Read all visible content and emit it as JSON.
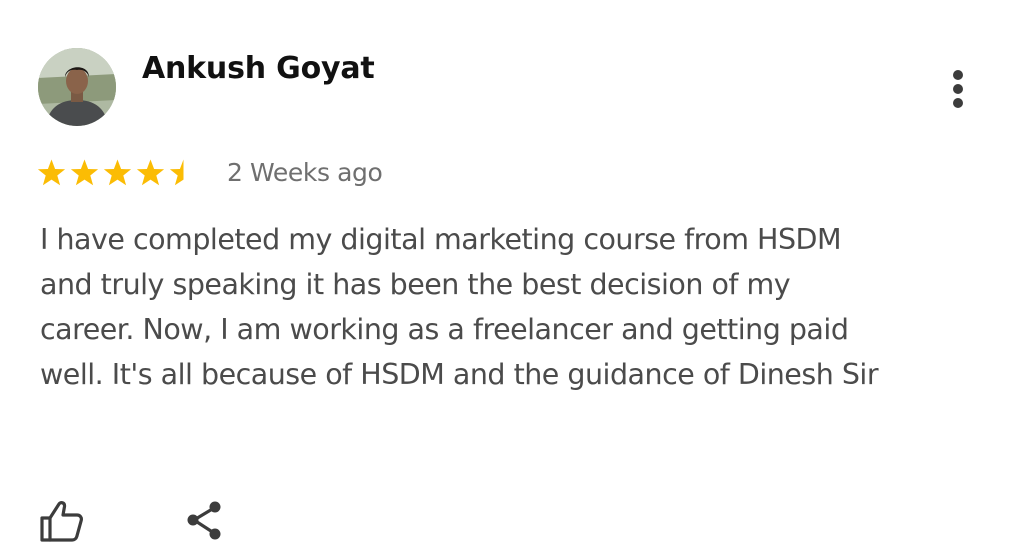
{
  "review": {
    "author_name": "Ankush Goyat",
    "rating": 4.5,
    "rating_max": 5,
    "time_ago": "2 Weeks ago",
    "text_lines": [
      "I have completed my digital marketing course from HSDM",
      "and truly speaking it has been the best decision of my",
      "career. Now, I am working as a freelancer and getting paid",
      "well. It's all because of HSDM and the guidance of Dinesh Sir"
    ]
  },
  "icons": {
    "avatar": "avatar-photo",
    "more": "more-vertical-icon",
    "star": "star-icon",
    "like": "thumbs-up-icon",
    "share": "share-icon"
  },
  "colors": {
    "star": "#fbbc04",
    "star_empty": "#dadce0",
    "name": "#111111",
    "meta": "#6f6f6f",
    "body": "#4b4b4b",
    "icon": "#3c3c3c"
  }
}
